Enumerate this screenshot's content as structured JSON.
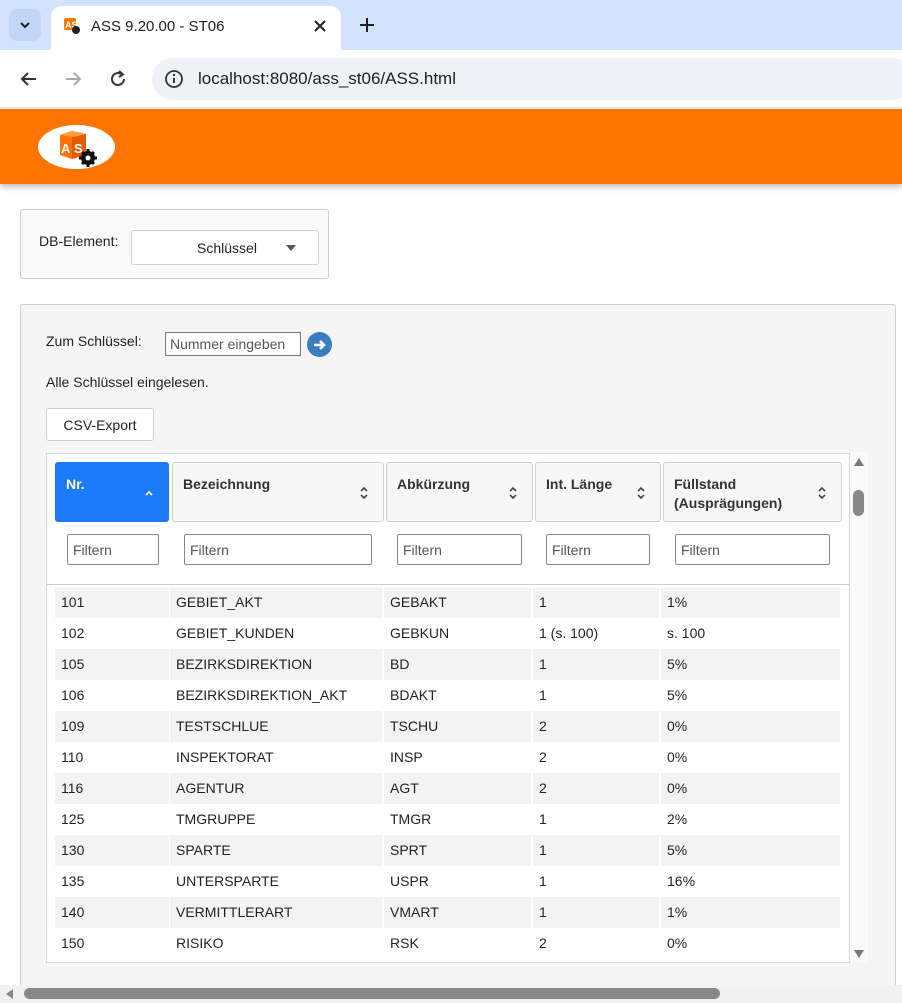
{
  "browser": {
    "tab_title": "ASS 9.20.00 - ST06",
    "url": "localhost:8080/ass_st06/ASS.html"
  },
  "colors": {
    "header": "#ff7300",
    "accent": "#1a7af8",
    "go_button": "#3b7dc1"
  },
  "db_element": {
    "label": "DB-Element:",
    "selected": "Schlüssel"
  },
  "goto": {
    "label": "Zum Schlüssel:",
    "placeholder": "Nummer eingeben"
  },
  "status": "Alle Schlüssel eingelesen.",
  "csv_label": "CSV-Export",
  "table": {
    "columns": [
      {
        "label": "Nr.",
        "sort": "ascending",
        "active": true
      },
      {
        "label": "Bezeichnung",
        "sort": "none",
        "active": false
      },
      {
        "label": "Abkürzung",
        "sort": "none",
        "active": false
      },
      {
        "label": "Int. Länge",
        "sort": "none",
        "active": false
      },
      {
        "label": "Füllstand (Ausprägungen)",
        "sort": "none",
        "active": false
      }
    ],
    "filter_placeholder": "Filtern",
    "rows": [
      [
        "101",
        "GEBIET_AKT",
        "GEBAKT",
        "1",
        "1%"
      ],
      [
        "102",
        "GEBIET_KUNDEN",
        "GEBKUN",
        "1 (s. 100)",
        "s. 100"
      ],
      [
        "105",
        "BEZIRKSDIREKTION",
        "BD",
        "1",
        "5%"
      ],
      [
        "106",
        "BEZIRKSDIREKTION_AKT",
        "BDAKT",
        "1",
        "5%"
      ],
      [
        "109",
        "TESTSCHLUE",
        "TSCHU",
        "2",
        "0%"
      ],
      [
        "110",
        "INSPEKTORAT",
        "INSP",
        "2",
        "0%"
      ],
      [
        "116",
        "AGENTUR",
        "AGT",
        "2",
        "0%"
      ],
      [
        "125",
        "TMGRUPPE",
        "TMGR",
        "1",
        "2%"
      ],
      [
        "130",
        "SPARTE",
        "SPRT",
        "1",
        "5%"
      ],
      [
        "135",
        "UNTERSPARTE",
        "USPR",
        "1",
        "16%"
      ],
      [
        "140",
        "VERMITTLERART",
        "VMART",
        "1",
        "1%"
      ],
      [
        "150",
        "RISIKO",
        "RSK",
        "2",
        "0%"
      ]
    ]
  }
}
